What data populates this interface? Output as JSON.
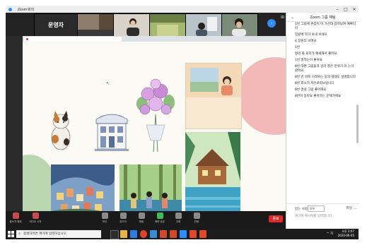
{
  "window": {
    "title": "Zoom 회의"
  },
  "share_bar": {
    "status": "",
    "options": ""
  },
  "gallery": {
    "host_label": "운영자",
    "tiles": [
      "",
      "",
      "",
      "",
      "",
      ""
    ]
  },
  "browser_tab": {
    "title": ""
  },
  "slide": {
    "text_card": "",
    "pointer_caption": ""
  },
  "controls": {
    "items": [
      "음소거 해제",
      "비디오 시작",
      "보안",
      "참가자",
      "채팅",
      "화면 공유",
      "기록",
      "반응"
    ],
    "end_label": "종료"
  },
  "chat": {
    "title": "Zoom 그룹 채팅",
    "messages": [
      {
        "from": "",
        "text": "1번 그림에 손잡이 아 가산대 잡혀보여 예쁘더라"
      },
      {
        "from": "",
        "text": "집앞에 작가 보내 보네요"
      },
      {
        "from": "",
        "text": "4 장원리 보여요"
      },
      {
        "from": "",
        "text": "1번"
      },
      {
        "from": "",
        "text": "컬러 볼 되지가 예세해서 좋아요"
      },
      {
        "from": "",
        "text": "1번 발자는이 좋아요"
      },
      {
        "from": "",
        "text": "8번 대편 그림들과 일러 잘은 분위기 이 는거 같아요"
      },
      {
        "from": "",
        "text": "8번 빈 바로 시작되는 동의 생태도 설명합니다"
      },
      {
        "from": "",
        "text": "8번 외소가 자유로워보입니다"
      },
      {
        "from": "",
        "text": "8번 얼굴 그림 좋아해요"
      },
      {
        "from": "",
        "text": "8번이 동아요 좋아하는 문재가에요"
      }
    ],
    "to_label": "받는 사람:",
    "to_value": "모두",
    "file_label": "파일",
    "input_placeholder": "여기에 메시지를 입력합니다..."
  },
  "taskbar": {
    "search_placeholder": "검색하려면 여기에 입력하십시오.",
    "time": "오후 2:07",
    "date": "2020-06-05",
    "tray": "^ 가"
  },
  "colors": {
    "zoom_blue": "#2d8cff",
    "share_green": "#3dbc57",
    "end_red": "#e02828",
    "pink": "#f3b9b9",
    "green": "#b9d6b0"
  }
}
